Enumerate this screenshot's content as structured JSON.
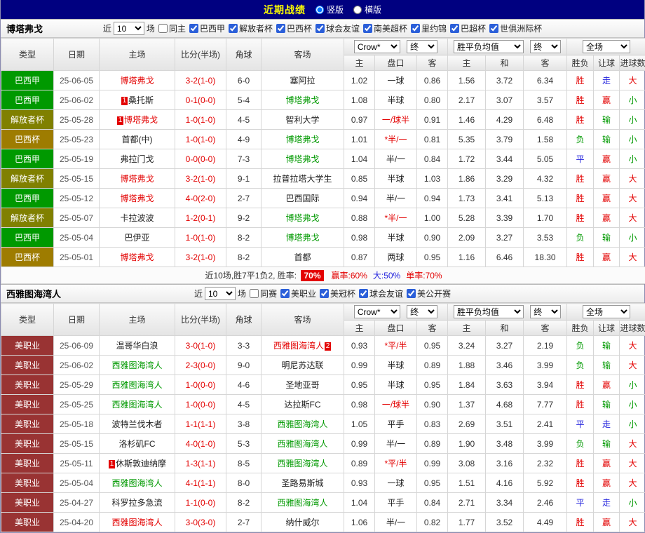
{
  "colors": {
    "red": "#e30000",
    "green": "#009900",
    "blue": "#2323dd",
    "black": "#222222",
    "navy": "#000080",
    "title_yellow": "#ffff00"
  },
  "top_bar": {
    "title": "近期战绩",
    "layout_options": [
      {
        "label": "竖版",
        "selected": true
      },
      {
        "label": "横版",
        "selected": false
      }
    ]
  },
  "table_header": {
    "type": "类型",
    "date": "日期",
    "home": "主场",
    "score": "比分(半场)",
    "corner": "角球",
    "away": "客场",
    "bookmaker_select": "Crow*",
    "odds_final_select": "终",
    "odds_home": "主",
    "odds_line": "盘口",
    "odds_away": "客",
    "avg_select": "胜平负均值",
    "avg_final_select": "终",
    "avg_home": "主",
    "avg_draw": "和",
    "avg_away": "客",
    "scope_select": "全场",
    "res_wdl": "胜负",
    "res_handicap": "让球",
    "res_goals": "进球数"
  },
  "sections": [
    {
      "team": "博塔弗戈",
      "near_label": "近",
      "count": "10",
      "games_label": "场",
      "filters": [
        {
          "label": "同主",
          "checked": false
        },
        {
          "label": "巴西甲",
          "checked": true
        },
        {
          "label": "解放者杯",
          "checked": true
        },
        {
          "label": "巴西杯",
          "checked": true
        },
        {
          "label": "球会友谊",
          "checked": true
        },
        {
          "label": "南美超杯",
          "checked": true
        },
        {
          "label": "里约锦",
          "checked": true
        },
        {
          "label": "巴超杯",
          "checked": true
        },
        {
          "label": "世俱洲际杯",
          "checked": true
        }
      ],
      "rows": [
        {
          "type": "巴西甲",
          "type_color": "#009900",
          "date": "25-06-05",
          "home": {
            "name": "博塔弗戈",
            "color": "red"
          },
          "score": "3-2(1-0)",
          "corner": "6-0",
          "away": {
            "name": "塞阿拉",
            "color": "black"
          },
          "odds": {
            "home": "1.02",
            "line": "一球",
            "line_red": false,
            "away": "0.86"
          },
          "avg": {
            "home": "1.56",
            "draw": "3.72",
            "away": "6.34"
          },
          "outcome": {
            "wdl": "胜",
            "wdl_c": "red",
            "let": "走",
            "let_c": "blue",
            "goal": "大",
            "goal_c": "red"
          }
        },
        {
          "type": "巴西甲",
          "type_color": "#009900",
          "date": "25-06-02",
          "home": {
            "name": "桑托斯",
            "color": "black",
            "badge": "1",
            "badge_pos": "before"
          },
          "score": "0-1(0-0)",
          "corner": "5-4",
          "away": {
            "name": "博塔弗戈",
            "color": "green"
          },
          "odds": {
            "home": "1.08",
            "line": "半球",
            "line_red": false,
            "away": "0.80"
          },
          "avg": {
            "home": "2.17",
            "draw": "3.07",
            "away": "3.57"
          },
          "outcome": {
            "wdl": "胜",
            "wdl_c": "red",
            "let": "赢",
            "let_c": "red",
            "goal": "小",
            "goal_c": "green"
          }
        },
        {
          "type": "解放者杯",
          "type_color": "#808000",
          "date": "25-05-28",
          "home": {
            "name": "博塔弗戈",
            "color": "red",
            "badge": "1",
            "badge_pos": "before"
          },
          "score": "1-0(1-0)",
          "corner": "4-5",
          "away": {
            "name": "智利大学",
            "color": "black"
          },
          "odds": {
            "home": "0.97",
            "line": "一/球半",
            "line_red": true,
            "away": "0.91"
          },
          "avg": {
            "home": "1.46",
            "draw": "4.29",
            "away": "6.48"
          },
          "outcome": {
            "wdl": "胜",
            "wdl_c": "red",
            "let": "输",
            "let_c": "green",
            "goal": "小",
            "goal_c": "green"
          }
        },
        {
          "type": "巴西杯",
          "type_color": "#9e7c00",
          "date": "25-05-23",
          "home": {
            "name": "首都(中)",
            "color": "black"
          },
          "score": "1-0(1-0)",
          "corner": "4-9",
          "away": {
            "name": "博塔弗戈",
            "color": "green"
          },
          "odds": {
            "home": "1.01",
            "line": "*半/一",
            "line_red": true,
            "away": "0.81"
          },
          "avg": {
            "home": "5.35",
            "draw": "3.79",
            "away": "1.58"
          },
          "outcome": {
            "wdl": "负",
            "wdl_c": "green",
            "let": "输",
            "let_c": "green",
            "goal": "小",
            "goal_c": "green"
          }
        },
        {
          "type": "巴西甲",
          "type_color": "#009900",
          "date": "25-05-19",
          "home": {
            "name": "弗拉门戈",
            "color": "black"
          },
          "score": "0-0(0-0)",
          "corner": "7-3",
          "away": {
            "name": "博塔弗戈",
            "color": "green"
          },
          "odds": {
            "home": "1.04",
            "line": "半/一",
            "line_red": false,
            "away": "0.84"
          },
          "avg": {
            "home": "1.72",
            "draw": "3.44",
            "away": "5.05"
          },
          "outcome": {
            "wdl": "平",
            "wdl_c": "blue",
            "let": "赢",
            "let_c": "red",
            "goal": "小",
            "goal_c": "green"
          }
        },
        {
          "type": "解放者杯",
          "type_color": "#808000",
          "date": "25-05-15",
          "home": {
            "name": "博塔弗戈",
            "color": "red"
          },
          "score": "3-2(1-0)",
          "corner": "9-1",
          "away": {
            "name": "拉普拉塔大学生",
            "color": "black"
          },
          "odds": {
            "home": "0.85",
            "line": "半球",
            "line_red": false,
            "away": "1.03"
          },
          "avg": {
            "home": "1.86",
            "draw": "3.29",
            "away": "4.32"
          },
          "outcome": {
            "wdl": "胜",
            "wdl_c": "red",
            "let": "赢",
            "let_c": "red",
            "goal": "大",
            "goal_c": "red"
          }
        },
        {
          "type": "巴西甲",
          "type_color": "#009900",
          "date": "25-05-12",
          "home": {
            "name": "博塔弗戈",
            "color": "red"
          },
          "score": "4-0(2-0)",
          "corner": "2-7",
          "away": {
            "name": "巴西国际",
            "color": "black"
          },
          "odds": {
            "home": "0.94",
            "line": "半/一",
            "line_red": false,
            "away": "0.94"
          },
          "avg": {
            "home": "1.73",
            "draw": "3.41",
            "away": "5.13"
          },
          "outcome": {
            "wdl": "胜",
            "wdl_c": "red",
            "let": "赢",
            "let_c": "red",
            "goal": "大",
            "goal_c": "red"
          }
        },
        {
          "type": "解放者杯",
          "type_color": "#808000",
          "date": "25-05-07",
          "home": {
            "name": "卡拉波波",
            "color": "black"
          },
          "score": "1-2(0-1)",
          "corner": "9-2",
          "away": {
            "name": "博塔弗戈",
            "color": "green"
          },
          "odds": {
            "home": "0.88",
            "line": "*半/一",
            "line_red": true,
            "away": "1.00"
          },
          "avg": {
            "home": "5.28",
            "draw": "3.39",
            "away": "1.70"
          },
          "outcome": {
            "wdl": "胜",
            "wdl_c": "red",
            "let": "赢",
            "let_c": "red",
            "goal": "大",
            "goal_c": "red"
          }
        },
        {
          "type": "巴西甲",
          "type_color": "#009900",
          "date": "25-05-04",
          "home": {
            "name": "巴伊亚",
            "color": "black"
          },
          "score": "1-0(1-0)",
          "corner": "8-2",
          "away": {
            "name": "博塔弗戈",
            "color": "green"
          },
          "odds": {
            "home": "0.98",
            "line": "半球",
            "line_red": false,
            "away": "0.90"
          },
          "avg": {
            "home": "2.09",
            "draw": "3.27",
            "away": "3.53"
          },
          "outcome": {
            "wdl": "负",
            "wdl_c": "green",
            "let": "输",
            "let_c": "green",
            "goal": "小",
            "goal_c": "green"
          }
        },
        {
          "type": "巴西杯",
          "type_color": "#9e7c00",
          "date": "25-05-01",
          "home": {
            "name": "博塔弗戈",
            "color": "red"
          },
          "score": "3-2(1-0)",
          "corner": "8-2",
          "away": {
            "name": "首都",
            "color": "black"
          },
          "odds": {
            "home": "0.87",
            "line": "两球",
            "line_red": false,
            "away": "0.95"
          },
          "avg": {
            "home": "1.16",
            "draw": "6.46",
            "away": "18.30"
          },
          "outcome": {
            "wdl": "胜",
            "wdl_c": "red",
            "let": "赢",
            "let_c": "red",
            "goal": "大",
            "goal_c": "red"
          }
        }
      ],
      "summary": {
        "prefix": "近10场,胜7平1负2, 胜率: ",
        "win_rate": "70%",
        "win_pct": {
          "text": "赢率:60%",
          "color": "#e30000"
        },
        "big_pct": {
          "text": "大:50%",
          "color": "#2323dd"
        },
        "single_pct": {
          "text": "单率:70%",
          "color": "#e30000"
        }
      }
    },
    {
      "team": "西雅图海湾人",
      "near_label": "近",
      "count": "10",
      "games_label": "场",
      "filters": [
        {
          "label": "同赛",
          "checked": false
        },
        {
          "label": "美职业",
          "checked": true
        },
        {
          "label": "美冠杯",
          "checked": true
        },
        {
          "label": "球会友谊",
          "checked": true
        },
        {
          "label": "美公开赛",
          "checked": true
        }
      ],
      "rows": [
        {
          "type": "美职业",
          "type_color": "#993333",
          "date": "25-06-09",
          "home": {
            "name": "温哥华白浪",
            "color": "black"
          },
          "score": "3-0(1-0)",
          "corner": "3-3",
          "away": {
            "name": "西雅图海湾人",
            "color": "red",
            "badge": "2",
            "badge_pos": "after"
          },
          "odds": {
            "home": "0.93",
            "line": "*平/半",
            "line_red": true,
            "away": "0.95"
          },
          "avg": {
            "home": "3.24",
            "draw": "3.27",
            "away": "2.19"
          },
          "outcome": {
            "wdl": "负",
            "wdl_c": "green",
            "let": "输",
            "let_c": "green",
            "goal": "大",
            "goal_c": "red"
          }
        },
        {
          "type": "美职业",
          "type_color": "#993333",
          "date": "25-06-02",
          "home": {
            "name": "西雅图海湾人",
            "color": "green"
          },
          "score": "2-3(0-0)",
          "corner": "9-0",
          "away": {
            "name": "明尼苏达联",
            "color": "black"
          },
          "odds": {
            "home": "0.99",
            "line": "半球",
            "line_red": false,
            "away": "0.89"
          },
          "avg": {
            "home": "1.88",
            "draw": "3.46",
            "away": "3.99"
          },
          "outcome": {
            "wdl": "负",
            "wdl_c": "green",
            "let": "输",
            "let_c": "green",
            "goal": "大",
            "goal_c": "red"
          }
        },
        {
          "type": "美职业",
          "type_color": "#993333",
          "date": "25-05-29",
          "home": {
            "name": "西雅图海湾人",
            "color": "green"
          },
          "score": "1-0(0-0)",
          "corner": "4-6",
          "away": {
            "name": "圣地亚哥",
            "color": "black"
          },
          "odds": {
            "home": "0.95",
            "line": "半球",
            "line_red": false,
            "away": "0.95"
          },
          "avg": {
            "home": "1.84",
            "draw": "3.63",
            "away": "3.94"
          },
          "outcome": {
            "wdl": "胜",
            "wdl_c": "red",
            "let": "赢",
            "let_c": "red",
            "goal": "小",
            "goal_c": "green"
          }
        },
        {
          "type": "美职业",
          "type_color": "#993333",
          "date": "25-05-25",
          "home": {
            "name": "西雅图海湾人",
            "color": "green"
          },
          "score": "1-0(0-0)",
          "corner": "4-5",
          "away": {
            "name": "达拉斯FC",
            "color": "black"
          },
          "odds": {
            "home": "0.98",
            "line": "一/球半",
            "line_red": true,
            "away": "0.90"
          },
          "avg": {
            "home": "1.37",
            "draw": "4.68",
            "away": "7.77"
          },
          "outcome": {
            "wdl": "胜",
            "wdl_c": "red",
            "let": "输",
            "let_c": "green",
            "goal": "小",
            "goal_c": "green"
          }
        },
        {
          "type": "美职业",
          "type_color": "#993333",
          "date": "25-05-18",
          "home": {
            "name": "波特兰伐木者",
            "color": "black"
          },
          "score": "1-1(1-1)",
          "corner": "3-8",
          "away": {
            "name": "西雅图海湾人",
            "color": "green"
          },
          "odds": {
            "home": "1.05",
            "line": "平手",
            "line_red": false,
            "away": "0.83"
          },
          "avg": {
            "home": "2.69",
            "draw": "3.51",
            "away": "2.41"
          },
          "outcome": {
            "wdl": "平",
            "wdl_c": "blue",
            "let": "走",
            "let_c": "blue",
            "goal": "小",
            "goal_c": "green"
          }
        },
        {
          "type": "美职业",
          "type_color": "#993333",
          "date": "25-05-15",
          "home": {
            "name": "洛杉矶FC",
            "color": "black"
          },
          "score": "4-0(1-0)",
          "corner": "5-3",
          "away": {
            "name": "西雅图海湾人",
            "color": "green"
          },
          "odds": {
            "home": "0.99",
            "line": "半/一",
            "line_red": false,
            "away": "0.89"
          },
          "avg": {
            "home": "1.90",
            "draw": "3.48",
            "away": "3.99"
          },
          "outcome": {
            "wdl": "负",
            "wdl_c": "green",
            "let": "输",
            "let_c": "green",
            "goal": "大",
            "goal_c": "red"
          }
        },
        {
          "type": "美职业",
          "type_color": "#993333",
          "date": "25-05-11",
          "home": {
            "name": "休斯敦迪纳摩",
            "color": "black",
            "badge": "1",
            "badge_pos": "before"
          },
          "score": "1-3(1-1)",
          "corner": "8-5",
          "away": {
            "name": "西雅图海湾人",
            "color": "green"
          },
          "odds": {
            "home": "0.89",
            "line": "*平/半",
            "line_red": true,
            "away": "0.99"
          },
          "avg": {
            "home": "3.08",
            "draw": "3.16",
            "away": "2.32"
          },
          "outcome": {
            "wdl": "胜",
            "wdl_c": "red",
            "let": "赢",
            "let_c": "red",
            "goal": "大",
            "goal_c": "red"
          }
        },
        {
          "type": "美职业",
          "type_color": "#993333",
          "date": "25-05-04",
          "home": {
            "name": "西雅图海湾人",
            "color": "green"
          },
          "score": "4-1(1-1)",
          "corner": "8-0",
          "away": {
            "name": "圣路易斯城",
            "color": "black"
          },
          "odds": {
            "home": "0.93",
            "line": "一球",
            "line_red": false,
            "away": "0.95"
          },
          "avg": {
            "home": "1.51",
            "draw": "4.16",
            "away": "5.92"
          },
          "outcome": {
            "wdl": "胜",
            "wdl_c": "red",
            "let": "赢",
            "let_c": "red",
            "goal": "大",
            "goal_c": "red"
          }
        },
        {
          "type": "美职业",
          "type_color": "#993333",
          "date": "25-04-27",
          "home": {
            "name": "科罗拉多急流",
            "color": "black"
          },
          "score": "1-1(0-0)",
          "corner": "8-2",
          "away": {
            "name": "西雅图海湾人",
            "color": "green"
          },
          "odds": {
            "home": "1.04",
            "line": "平手",
            "line_red": false,
            "away": "0.84"
          },
          "avg": {
            "home": "2.71",
            "draw": "3.34",
            "away": "2.46"
          },
          "outcome": {
            "wdl": "平",
            "wdl_c": "blue",
            "let": "走",
            "let_c": "blue",
            "goal": "小",
            "goal_c": "green"
          }
        },
        {
          "type": "美职业",
          "type_color": "#993333",
          "date": "25-04-20",
          "home": {
            "name": "西雅图海湾人",
            "color": "red"
          },
          "score": "3-0(3-0)",
          "corner": "2-7",
          "away": {
            "name": "纳什威尔",
            "color": "black"
          },
          "odds": {
            "home": "1.06",
            "line": "半/一",
            "line_red": false,
            "away": "0.82"
          },
          "avg": {
            "home": "1.77",
            "draw": "3.52",
            "away": "4.49"
          },
          "outcome": {
            "wdl": "胜",
            "wdl_c": "red",
            "let": "赢",
            "let_c": "red",
            "goal": "大",
            "goal_c": "red"
          }
        }
      ]
    }
  ]
}
